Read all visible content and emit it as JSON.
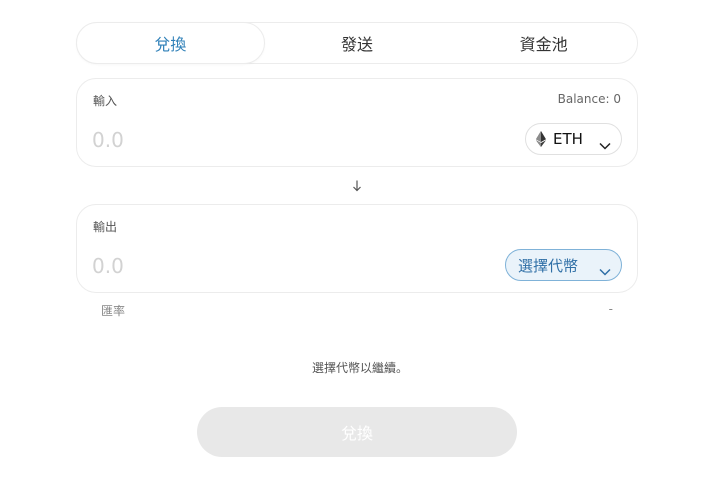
{
  "tabs": [
    {
      "label": "兌換",
      "active": true
    },
    {
      "label": "發送",
      "active": false
    },
    {
      "label": "資金池",
      "active": false
    }
  ],
  "input_panel": {
    "label": "輸入",
    "balance": "Balance: 0",
    "amount_placeholder": "0.0",
    "token": {
      "symbol": "ETH",
      "icon": "ethereum-icon"
    }
  },
  "output_panel": {
    "label": "輸出",
    "amount_placeholder": "0.0",
    "select_token_label": "選擇代幣"
  },
  "rate": {
    "label": "匯率",
    "value": "-"
  },
  "hint": "選擇代幣以繼續。",
  "swap_button": {
    "label": "兌換",
    "disabled": true
  },
  "colors": {
    "accent": "#2f80b8",
    "select_bg": "#eaf3fa",
    "select_border": "#7fb2d8",
    "disabled_button": "#e8e8e8"
  }
}
